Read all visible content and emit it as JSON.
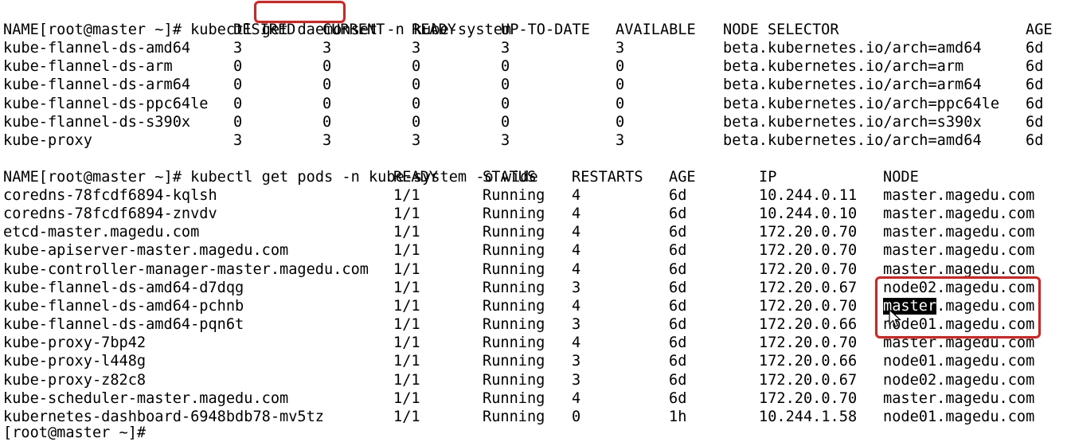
{
  "terminal": {
    "cmd1": {
      "prompt": "[root@master ~]# ",
      "command_pre": "kubectl get ",
      "highlight": "daemonset",
      "command_post": " -n kube-system"
    },
    "ds_headers": [
      "NAME",
      "DESIRED",
      "CURRENT",
      "READY",
      "UP-TO-DATE",
      "AVAILABLE",
      "NODE SELECTOR",
      "AGE"
    ],
    "ds_rows": [
      [
        "kube-flannel-ds-amd64",
        "3",
        "3",
        "3",
        "3",
        "3",
        "beta.kubernetes.io/arch=amd64",
        "6d"
      ],
      [
        "kube-flannel-ds-arm",
        "0",
        "0",
        "0",
        "0",
        "0",
        "beta.kubernetes.io/arch=arm",
        "6d"
      ],
      [
        "kube-flannel-ds-arm64",
        "0",
        "0",
        "0",
        "0",
        "0",
        "beta.kubernetes.io/arch=arm64",
        "6d"
      ],
      [
        "kube-flannel-ds-ppc64le",
        "0",
        "0",
        "0",
        "0",
        "0",
        "beta.kubernetes.io/arch=ppc64le",
        "6d"
      ],
      [
        "kube-flannel-ds-s390x",
        "0",
        "0",
        "0",
        "0",
        "0",
        "beta.kubernetes.io/arch=s390x",
        "6d"
      ],
      [
        "kube-proxy",
        "3",
        "3",
        "3",
        "3",
        "3",
        "beta.kubernetes.io/arch=amd64",
        "6d"
      ]
    ],
    "cmd2": {
      "prompt": "[root@master ~]# ",
      "command": "kubectl get pods -n kube-system -o wide"
    },
    "pod_headers": [
      "NAME",
      "READY",
      "STATUS",
      "RESTARTS",
      "AGE",
      "IP",
      "NODE"
    ],
    "pod_rows": [
      [
        "coredns-78fcdf6894-kqlsh",
        "1/1",
        "Running",
        "4",
        "6d",
        "10.244.0.11",
        "master.magedu.com"
      ],
      [
        "coredns-78fcdf6894-znvdv",
        "1/1",
        "Running",
        "4",
        "6d",
        "10.244.0.10",
        "master.magedu.com"
      ],
      [
        "etcd-master.magedu.com",
        "1/1",
        "Running",
        "4",
        "6d",
        "172.20.0.70",
        "master.magedu.com"
      ],
      [
        "kube-apiserver-master.magedu.com",
        "1/1",
        "Running",
        "4",
        "6d",
        "172.20.0.70",
        "master.magedu.com"
      ],
      [
        "kube-controller-manager-master.magedu.com",
        "1/1",
        "Running",
        "4",
        "6d",
        "172.20.0.70",
        "master.magedu.com"
      ],
      [
        "kube-flannel-ds-amd64-d7dqg",
        "1/1",
        "Running",
        "3",
        "6d",
        "172.20.0.67",
        "node02.magedu.com"
      ],
      [
        "kube-flannel-ds-amd64-pchnb",
        "1/1",
        "Running",
        "4",
        "6d",
        "172.20.0.70",
        "master.magedu.com"
      ],
      [
        "kube-flannel-ds-amd64-pqn6t",
        "1/1",
        "Running",
        "3",
        "6d",
        "172.20.0.66",
        "node01.magedu.com"
      ],
      [
        "kube-proxy-7bp42",
        "1/1",
        "Running",
        "4",
        "6d",
        "172.20.0.70",
        "master.magedu.com"
      ],
      [
        "kube-proxy-l448g",
        "1/1",
        "Running",
        "3",
        "6d",
        "172.20.0.66",
        "node01.magedu.com"
      ],
      [
        "kube-proxy-z82c8",
        "1/1",
        "Running",
        "3",
        "6d",
        "172.20.0.67",
        "node02.magedu.com"
      ],
      [
        "kube-scheduler-master.magedu.com",
        "1/1",
        "Running",
        "4",
        "6d",
        "172.20.0.70",
        "master.magedu.com"
      ],
      [
        "kubernetes-dashboard-6948bdb78-mv5tz",
        "1/1",
        "Running",
        "0",
        "1h",
        "10.244.1.58",
        "node01.magedu.com"
      ]
    ],
    "selected_text": "master",
    "partial_prompt": "[root@master ~]# "
  },
  "colors": {
    "background": "#ffffff",
    "text": "#000000",
    "annotation_red": "#e0201c",
    "selection_bg": "#000000",
    "selection_fg": "#ffffff"
  },
  "icons": {
    "mouse": "arrow-cursor-icon"
  }
}
